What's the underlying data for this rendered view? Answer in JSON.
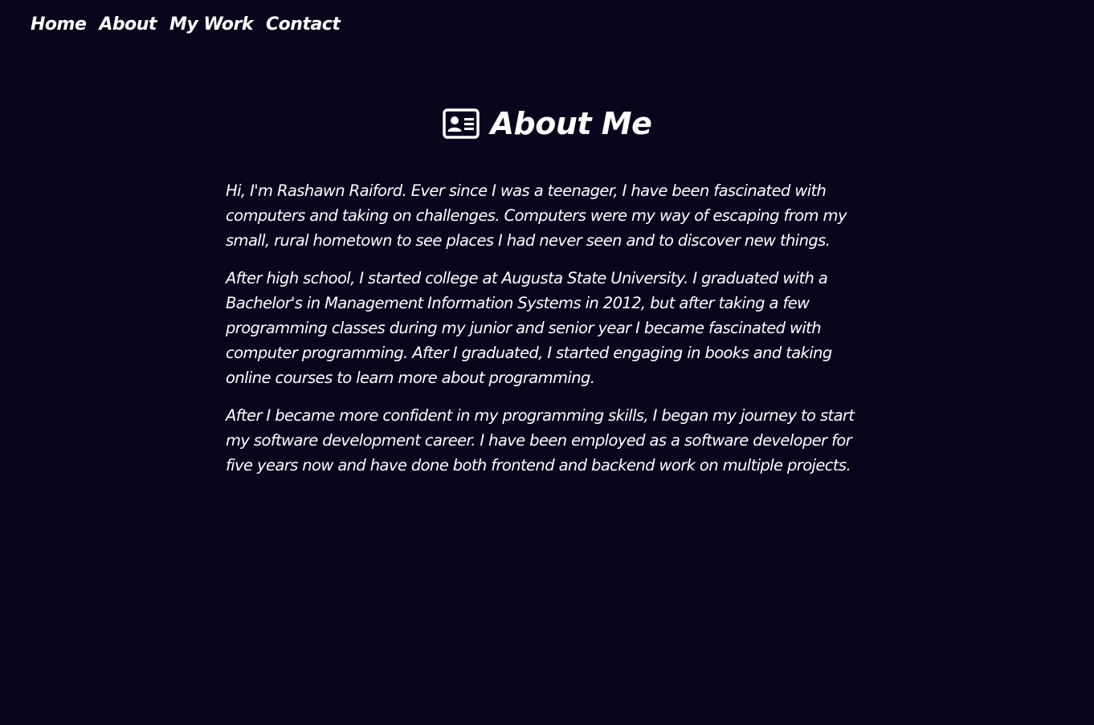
{
  "nav": {
    "home": "Home",
    "about": "About",
    "my_work": "My Work",
    "contact": "Contact"
  },
  "heading": {
    "icon": "id-card-icon",
    "title": "About Me"
  },
  "paragraphs": [
    "Hi, I'm Rashawn Raiford. Ever since I was a teenager, I have been fascinated with computers and taking on challenges. Computers were my way of escaping from my small, rural hometown to see places I had never seen and to discover new things.",
    "After high school, I started college at Augusta State University. I graduated with a Bachelor's in Management Information Systems in 2012, but after taking a few programming classes during my junior and senior year I became fascinated with computer programming. After I graduated, I started engaging in books and taking online courses to learn more about programming.",
    "After I became more confident in my programming skills, I began my journey to start my software development career. I have been employed as a software developer for five years now and have done both frontend and backend work on multiple projects."
  ],
  "colors": {
    "background": "#08051c",
    "text": "#ffffff"
  }
}
